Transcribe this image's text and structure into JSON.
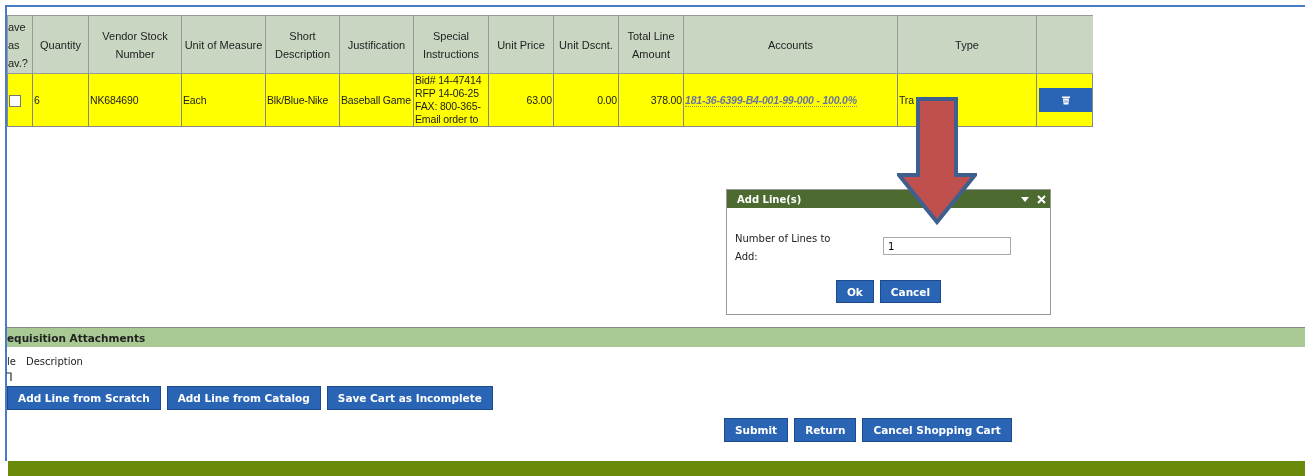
{
  "table": {
    "columns": [
      "ave as av.?",
      "Quantity",
      "Vendor Stock Number",
      "Unit of Measure",
      "Short Description",
      "Justification",
      "Special Instructions",
      "Unit Price",
      "Unit Dscnt.",
      "Total Line Amount",
      "Accounts",
      "Type"
    ],
    "rows": [
      {
        "checked": false,
        "quantity": "6",
        "vendor_stock_number": "NK684690",
        "unit_of_measure": "Each",
        "short_description": "Blk/Blue-Nike",
        "justification": "Baseball Game",
        "special_instructions": [
          "Bid# 14-47414",
          "RFP 14-06-25",
          "FAX: 800-365-",
          "Email order to"
        ],
        "unit_price": "63.00",
        "unit_discount": "0.00",
        "total_line_amount": "378.00",
        "accounts": "181-36-6399-B4-001-99-000 - 100.0%",
        "type": "Tra"
      }
    ]
  },
  "dialog": {
    "title": "Add Line(s)",
    "field_label": "Number of Lines to Add:",
    "value": "1",
    "buttons": [
      {
        "label": "Ok"
      },
      {
        "label": "Cancel"
      }
    ]
  },
  "attachments": {
    "title": "equisition Attachments",
    "columns": [
      "le",
      "Description"
    ]
  },
  "line_buttons": [
    {
      "label": "Add Line from Scratch"
    },
    {
      "label": "Add Line from Catalog"
    },
    {
      "label": "Save Cart as Incomplete"
    }
  ],
  "cart_buttons": [
    {
      "label": "Submit"
    },
    {
      "label": "Return"
    },
    {
      "label": "Cancel Shopping Cart"
    }
  ]
}
